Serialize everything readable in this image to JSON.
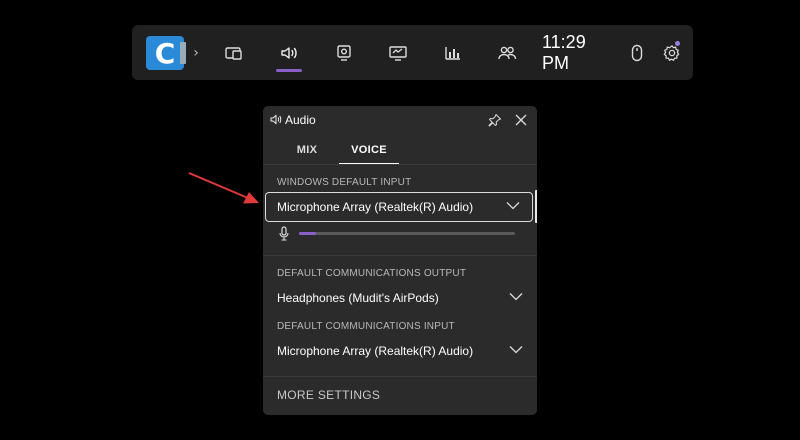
{
  "gamebar": {
    "app_icon_letter": "C",
    "expand_glyph": "›",
    "clock": "11:29 PM",
    "accent": "#8a5fc8",
    "icons": [
      "widget-store-icon",
      "audio-icon",
      "capture-icon",
      "performance-icon",
      "resources-icon",
      "xbox-social-icon",
      "mouse-icon",
      "settings-icon"
    ]
  },
  "audio_panel": {
    "title": "Audio",
    "tabs": [
      {
        "label": "MIX",
        "selected": false
      },
      {
        "label": "VOICE",
        "selected": true
      }
    ],
    "windows_default_input": {
      "label": "WINDOWS DEFAULT INPUT",
      "value": "Microphone Array (Realtek(R) Audio)",
      "mic_level": 0.08
    },
    "default_comm_output": {
      "label": "DEFAULT COMMUNICATIONS OUTPUT",
      "value": "Headphones (Mudit's AirPods)"
    },
    "default_comm_input": {
      "label": "DEFAULT COMMUNICATIONS INPUT",
      "value": "Microphone Array (Realtek(R) Audio)"
    },
    "more_settings": "MORE SETTINGS"
  },
  "annotation": {
    "color": "#e03a3a"
  }
}
